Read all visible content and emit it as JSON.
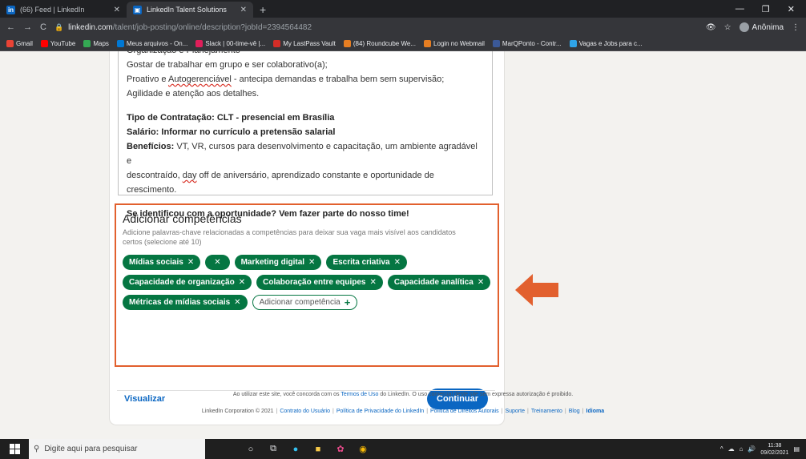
{
  "browser": {
    "tabs": [
      {
        "title": "(66) Feed | LinkedIn",
        "favicon": "in",
        "favicon_color": "#0a66c2",
        "active": false
      },
      {
        "title": "LinkedIn Talent Solutions",
        "favicon": "▣",
        "favicon_color": "#0a66c2",
        "active": true
      }
    ],
    "url_host": "linkedin.com",
    "url_path": "/talent/job-posting/online/description?jobId=2394564482",
    "profile_label": "Anônima",
    "bookmarks": [
      {
        "label": "Gmail",
        "color": "#ea4335"
      },
      {
        "label": "YouTube",
        "color": "#ff0000"
      },
      {
        "label": "Maps",
        "color": "#34a853"
      },
      {
        "label": "Meus arquivos - On...",
        "color": "#0078d4"
      },
      {
        "label": "Slack | 00-time-vê |...",
        "color": "#e01e5a"
      },
      {
        "label": "My LastPass Vault",
        "color": "#d32d27"
      },
      {
        "label": "(84) Roundcube We...",
        "color": "#e67e22"
      },
      {
        "label": "Login no Webmail",
        "color": "#e67e22"
      },
      {
        "label": "MarQPonto - Contr...",
        "color": "#3b5998"
      },
      {
        "label": "Vagas e Jobs para c...",
        "color": "#2fa4e7"
      }
    ]
  },
  "description": {
    "line_clipped": "Organização e Planejamento",
    "line_1": "Gostar de trabalhar em grupo e ser colaborativo(a);",
    "line_2_pre": "Proativo e ",
    "line_2_mark": "Autogerenciável",
    "line_2_post": " - antecipa demandas e trabalha bem sem supervisão;",
    "line_3": "Agilidade e atenção aos detalhes.",
    "contract": "Tipo de Contratação: CLT - presencial em Brasília",
    "salary": "Salário: Informar no currículo a pretensão salarial",
    "benefits_label": "Benefícios:",
    "benefits_text_1": " VT, VR, cursos para desenvolvimento e capacitação, um ambiente agradável e",
    "benefits_text_2_pre": "descontraído, ",
    "benefits_text_2_mark": "day",
    "benefits_text_2_post": " off de aniversário, aprendizado constante e oportunidade de crescimento.",
    "closing": "Se identificou com a oportunidade? Vem fazer parte do nosso time!"
  },
  "skills": {
    "title": "Adicionar competências",
    "help": "Adicione palavras-chave relacionadas a competências para deixar sua vaga mais visível aos candidatos certos (selecione até 10)",
    "chips": [
      "Mídias sociais",
      "",
      "Marketing digital",
      "Escrita criativa",
      "Capacidade de organização",
      "Colaboração entre equipes",
      "Capacidade analítica",
      "Métricas de mídias sociais"
    ],
    "remove_glyph": "✕",
    "add_label": "Adicionar competência",
    "add_glyph": "+"
  },
  "actions": {
    "preview_label": "Visualizar",
    "continue_label": "Continuar"
  },
  "annotation_color": "#e2602e",
  "page_footer": {
    "terms_pre": "Ao utilizar este site, você concorda com os ",
    "terms_link": "Termos de Uso",
    "terms_post": " do LinkedIn. O uso comercial deste site sem expressa autorização é proibido.",
    "copyright": "LinkedIn Corporation © 2021",
    "links": [
      "Contrato do Usuário",
      "Política de Privacidade do LinkedIn",
      "Política de Direitos Autorais",
      "Suporte",
      "Treinamento",
      "Blog"
    ],
    "language": "Idioma"
  },
  "taskbar": {
    "search_placeholder": "Digite aqui para pesquisar",
    "time": "11:38",
    "date": "09/02/2021"
  }
}
